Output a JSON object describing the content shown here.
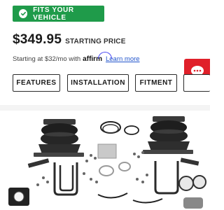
{
  "fit_button": {
    "label": "FITS YOUR VEHICLE",
    "icon": "check-circle-icon",
    "color": "#1f9b4a"
  },
  "pricing": {
    "price": "$349.95",
    "label": "STARTING PRICE",
    "financing_prefix": "Starting at $32/mo with",
    "financing_brand": "affirm",
    "learn_more": "Learn more"
  },
  "chat": {
    "icon": "chat-bubble-icon",
    "color": "#e0202a"
  },
  "tabs": [
    {
      "label": "FEATURES"
    },
    {
      "label": "INSTALLATION"
    },
    {
      "label": "FITMENT"
    },
    {
      "label": ""
    }
  ],
  "product_image": {
    "subject": "air spring suspension kit"
  }
}
